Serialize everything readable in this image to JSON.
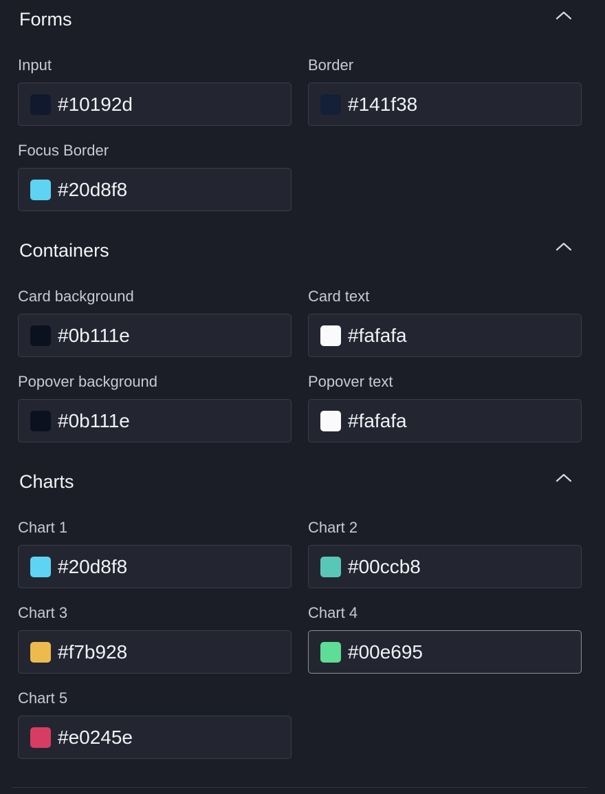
{
  "sections": [
    {
      "title": "Forms",
      "fields": [
        {
          "label": "Input",
          "value": "#10192d",
          "swatch": "#10192d"
        },
        {
          "label": "Border",
          "value": "#141f38",
          "swatch": "#141f38"
        },
        {
          "label": "Focus Border",
          "value": "#20d8f8",
          "swatch": "#5fd3f3"
        }
      ]
    },
    {
      "title": "Containers",
      "fields": [
        {
          "label": "Card background",
          "value": "#0b111e",
          "swatch": "#0b111e"
        },
        {
          "label": "Card text",
          "value": "#fafafa",
          "swatch": "#fafafa"
        },
        {
          "label": "Popover background",
          "value": "#0b111e",
          "swatch": "#0b111e"
        },
        {
          "label": "Popover text",
          "value": "#fafafa",
          "swatch": "#fafafa"
        }
      ]
    },
    {
      "title": "Charts",
      "fields": [
        {
          "label": "Chart 1",
          "value": "#20d8f8",
          "swatch": "#5fd3f3"
        },
        {
          "label": "Chart 2",
          "value": "#00ccb8",
          "swatch": "#59c7b8"
        },
        {
          "label": "Chart 3",
          "value": "#f7b928",
          "swatch": "#edbb4d"
        },
        {
          "label": "Chart 4",
          "value": "#00e695",
          "swatch": "#5ddd96"
        },
        {
          "label": "Chart 5",
          "value": "#e0245e",
          "swatch": "#d73d62"
        }
      ]
    }
  ]
}
